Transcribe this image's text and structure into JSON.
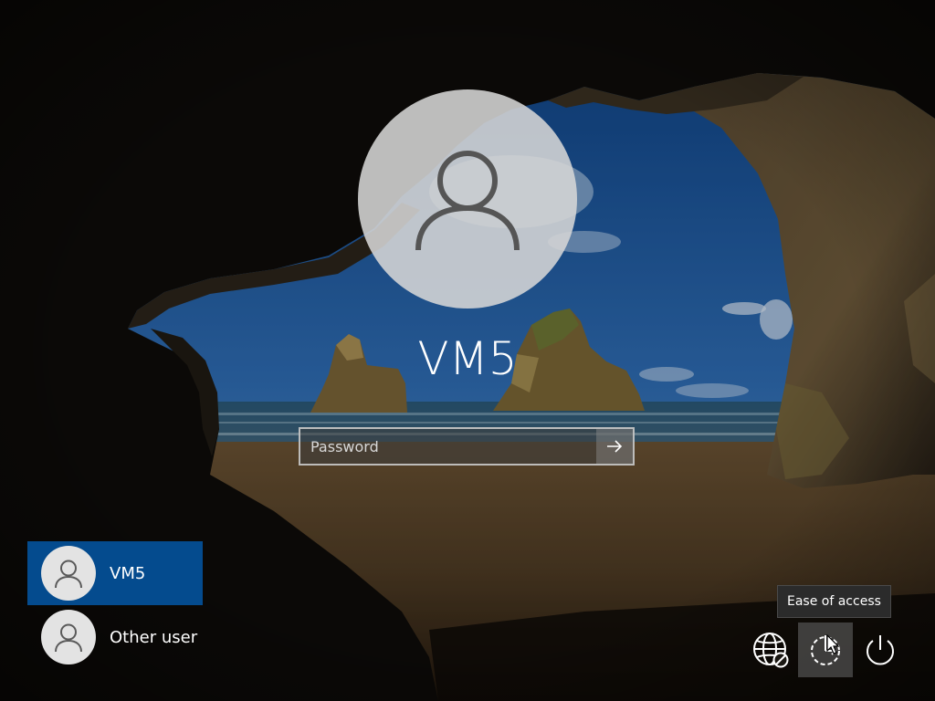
{
  "login": {
    "username": "VM5",
    "password_placeholder": "Password"
  },
  "user_list": [
    {
      "name": "VM5",
      "selected": true
    },
    {
      "name": "Other user",
      "selected": false
    }
  ],
  "controls": {
    "network_icon": "globe-network-icon",
    "ease_icon": "ease-of-access-icon",
    "power_icon": "power-icon",
    "tooltip": "Ease of access"
  },
  "colors": {
    "selected_user_bg": "#044b8e"
  }
}
